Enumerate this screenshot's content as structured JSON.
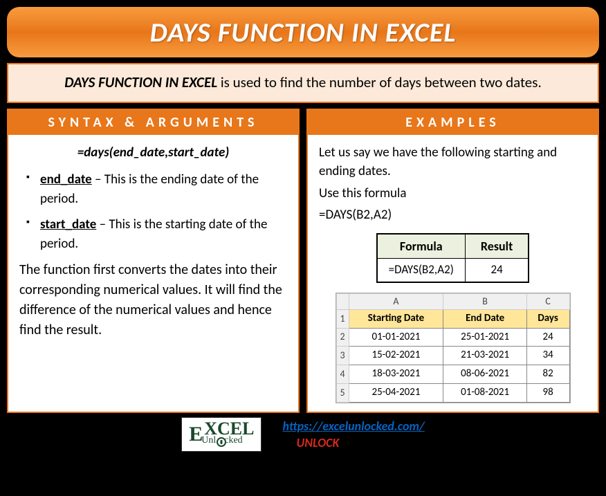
{
  "title": "DAYS FUNCTION IN EXCEL",
  "description": {
    "bold": "DAYS FUNCTION IN EXCEL",
    "rest": " is used to find the number of days between two dates."
  },
  "syntax": {
    "header": "SYNTAX & ARGUMENTS",
    "formula": "=days(end_date,start_date)",
    "args": [
      {
        "name": "end_date",
        "desc": " – This is the ending date of the period."
      },
      {
        "name": "start_date",
        "desc": " – This is the starting date of the period."
      }
    ],
    "explain": "The function first converts the dates into their corresponding numerical values. It will find the difference of the numerical values and hence find the result."
  },
  "examples": {
    "header": "EXAMPLES",
    "intro1": "Let us say we have the following starting and ending dates.",
    "intro2": "Use this formula",
    "intro3": "=DAYS(B2,A2)",
    "fr_table": {
      "h1": "Formula",
      "h2": "Result",
      "c1": "=DAYS(B2,A2)",
      "c2": "24"
    },
    "grid": {
      "cols": [
        "A",
        "B",
        "C"
      ],
      "header_row": [
        "Starting Date",
        "End Date",
        "Days"
      ],
      "rows": [
        [
          "01-01-2021",
          "25-01-2021",
          "24"
        ],
        [
          "15-02-2021",
          "21-03-2021",
          "34"
        ],
        [
          "18-03-2021",
          "08-06-2021",
          "82"
        ],
        [
          "25-04-2021",
          "01-08-2021",
          "98"
        ]
      ]
    }
  },
  "footer": {
    "logo_e": "E",
    "logo_xcel": "XCEL",
    "logo_sub": "Unl   cked",
    "link": "https://excelunlocked.com/",
    "unlock": "UNLOCK"
  }
}
